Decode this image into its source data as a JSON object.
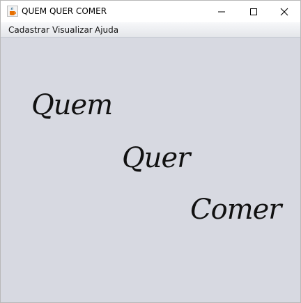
{
  "window": {
    "title": "QUEM QUER COMER"
  },
  "menu": {
    "items": [
      "Cadastrar",
      "Visualizar",
      "Ajuda"
    ]
  },
  "content": {
    "words": [
      "Quem",
      "Quer",
      "Comer"
    ]
  },
  "icons": {
    "app": "java-cup-icon",
    "minimize": "minimize-icon",
    "maximize": "maximize-icon",
    "close": "close-icon"
  },
  "colors": {
    "content_background": "#d7d9e1",
    "menubar": "#eceef1"
  }
}
